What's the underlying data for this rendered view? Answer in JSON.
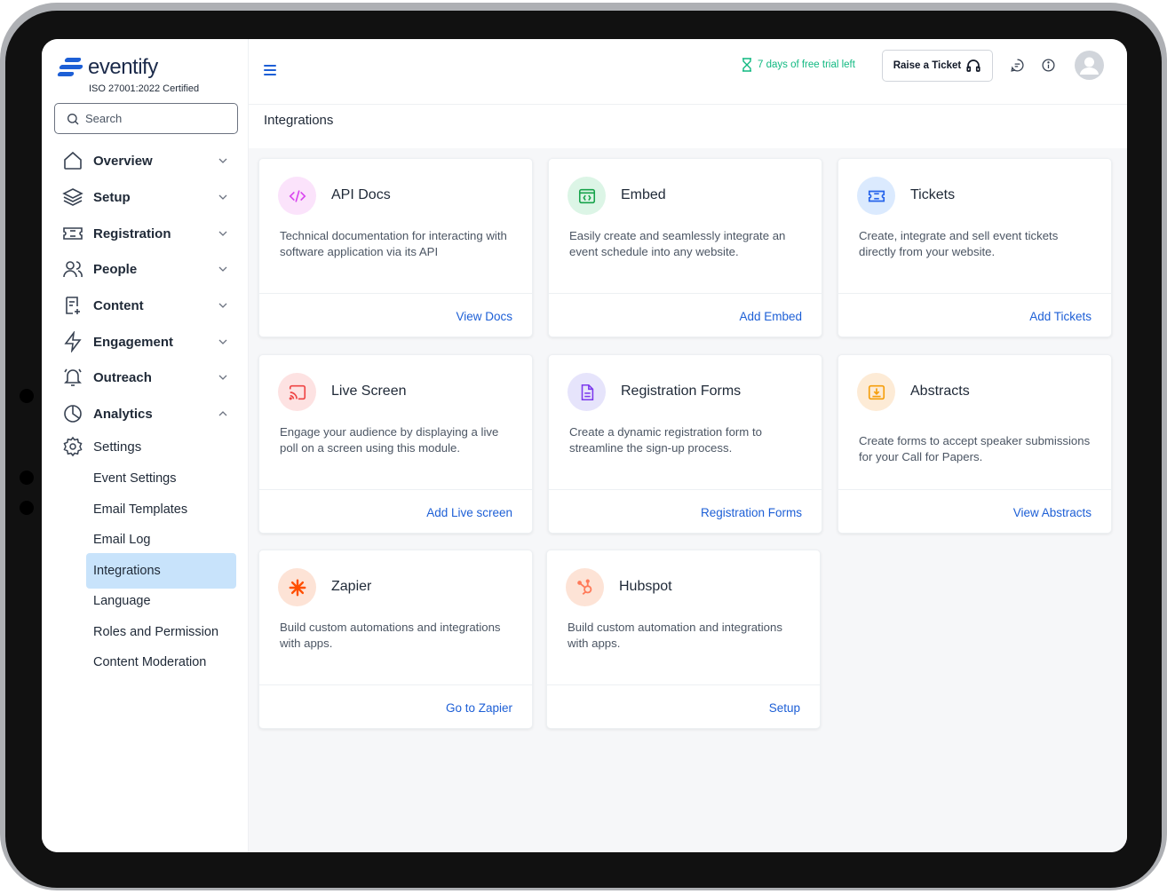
{
  "brand": {
    "name": "eventify",
    "certification": "ISO 27001:2022 Certified"
  },
  "search": {
    "placeholder": "Search"
  },
  "sidebar": {
    "items": [
      {
        "label": "Overview",
        "icon": "home-icon"
      },
      {
        "label": "Setup",
        "icon": "layers-icon"
      },
      {
        "label": "Registration",
        "icon": "ticket-icon"
      },
      {
        "label": "People",
        "icon": "users-icon"
      },
      {
        "label": "Content",
        "icon": "document-icon"
      },
      {
        "label": "Engagement",
        "icon": "lightning-icon"
      },
      {
        "label": "Outreach",
        "icon": "bell-icon"
      },
      {
        "label": "Analytics",
        "icon": "pie-chart-icon"
      },
      {
        "label": "Settings",
        "icon": "gear-icon"
      }
    ],
    "settings_sub": [
      {
        "label": "Event Settings"
      },
      {
        "label": "Email Templates"
      },
      {
        "label": "Email Log"
      },
      {
        "label": "Integrations",
        "active": true
      },
      {
        "label": "Language"
      },
      {
        "label": "Roles and Permission"
      },
      {
        "label": "Content Moderation"
      }
    ]
  },
  "topbar": {
    "trial_text": "7 days of free trial left",
    "ticket_button": "Raise a Ticket",
    "trial_color": "#10b981",
    "accent": "#1d5fd6"
  },
  "page": {
    "title": "Integrations"
  },
  "cards": [
    {
      "title": "API Docs",
      "description": "Technical documentation for interacting with software application via its API",
      "link": "View Docs",
      "icon": "code-icon",
      "icon_bg": "#fbe3fb",
      "icon_color": "#d946ef"
    },
    {
      "title": "Embed",
      "description": "Easily create and seamlessly integrate an event schedule into any website.",
      "link": "Add Embed",
      "icon": "embed-window-icon",
      "icon_bg": "#dcf5e6",
      "icon_color": "#16a34a"
    },
    {
      "title": "Tickets",
      "description": "Create, integrate and sell event tickets directly from your website.",
      "link": "Add Tickets",
      "icon": "ticket-icon",
      "icon_bg": "#dbeafe",
      "icon_color": "#2563eb"
    },
    {
      "title": "Live Screen",
      "description": "Engage your audience by displaying a live poll on a screen using this module.",
      "link": "Add Live screen",
      "icon": "cast-icon",
      "icon_bg": "#fde2e2",
      "icon_color": "#ef4444"
    },
    {
      "title": "Registration Forms",
      "description": "Create a dynamic registration form to streamline the sign-up process.",
      "link": "Registration Forms",
      "icon": "form-icon",
      "icon_bg": "#e6e4fb",
      "icon_color": "#7c3aed"
    },
    {
      "title": "Abstracts",
      "description": "Create forms to accept speaker submissions for your Call for Papers.",
      "link": "View Abstracts",
      "icon": "inbox-download-icon",
      "icon_bg": "#fdebd6",
      "icon_color": "#f59e0b"
    },
    {
      "title": "Zapier",
      "description": "Build custom automations and integrations with apps.",
      "link": "Go to Zapier",
      "icon": "zapier-asterisk-icon",
      "icon_bg": "#fde3d6",
      "icon_color": "#ff4f00"
    },
    {
      "title": "Hubspot",
      "description": "Build custom automation and integrations with apps.",
      "link": "Setup",
      "icon": "hubspot-icon",
      "icon_bg": "#fde3d6",
      "icon_color": "#ff7a59"
    }
  ]
}
